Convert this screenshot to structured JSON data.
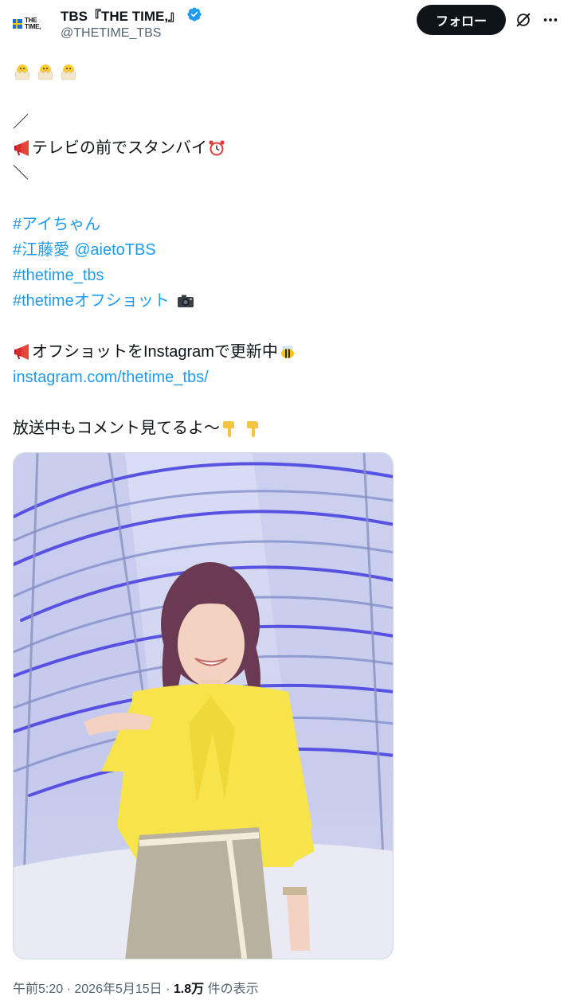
{
  "author": {
    "avatar_logo_line1": "THE",
    "avatar_logo_line2": "TIME,",
    "name": "TBS『THE TIME,』",
    "handle": "@THETIME_TBS",
    "verified_color": "#1d9bf0"
  },
  "actions": {
    "follow_label": "フォロー",
    "grok_icon": "grok-icon",
    "more_icon": "more-icon"
  },
  "tweet": {
    "line_slash_open": "／",
    "line_standby": "テレビの前でスタンバイ",
    "line_slash_close": "＼",
    "hashtag_ai": "#アイちゃん",
    "hashtag_eto": "#江藤愛",
    "mention": "@aietoTBS",
    "hashtag_thetime": "#thetime_tbs",
    "hashtag_offshot": "#thetimeオフショット",
    "line_instagram": "オフショットをInstagramで更新中",
    "instagram_link": "instagram.com/thetime_tbs/",
    "line_comment": "放送中もコメント見てるよ～"
  },
  "footer": {
    "time": "午前5:20",
    "sep1": " · ",
    "date": "2026年5月15日",
    "sep2": " · ",
    "view_count": "1.8万",
    "view_label": " 件の表示"
  }
}
